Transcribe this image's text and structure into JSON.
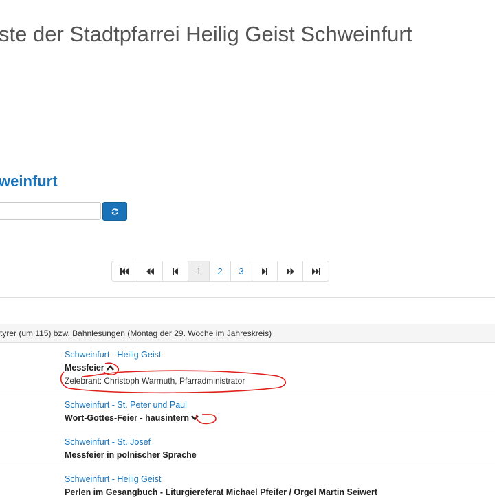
{
  "header": {
    "title": "ste der Stadtpfarrei Heilig Geist Schweinfurt"
  },
  "section": {
    "title": "weinfurt"
  },
  "search": {
    "value": "",
    "refresh_icon": "refresh-icon"
  },
  "pagination": {
    "pages": [
      "1",
      "2",
      "3"
    ],
    "active_page": "1",
    "icons": [
      "first-page-icon",
      "fast-back-icon",
      "prev-page-icon",
      "next-page-icon",
      "fast-forward-icon",
      "last-page-icon"
    ]
  },
  "day": {
    "header": "tyrer (um 115) bzw. Bahnlesungen (Montag der 29. Woche im Jahreskreis)"
  },
  "events": [
    {
      "location": "Schweinfurt - Heilig Geist",
      "title": "Messfeier",
      "expanded": true,
      "detail": "Zelebrant: Christoph Warmuth, Pfarradministrator"
    },
    {
      "location": "Schweinfurt - St. Peter und Paul",
      "title": "Wort-Gottes-Feier - hausintern",
      "expanded": false
    },
    {
      "location": "Schweinfurt - St. Josef",
      "title": "Messfeier in polnischer Sprache"
    },
    {
      "location": "Schweinfurt - Heilig Geist",
      "title": "Perlen im Gesangbuch - Liturgiereferat Michael Pfeifer / Orgel Martin Seiwert"
    }
  ],
  "colors": {
    "link": "#1a72b8",
    "annotation": "#e0201b"
  }
}
